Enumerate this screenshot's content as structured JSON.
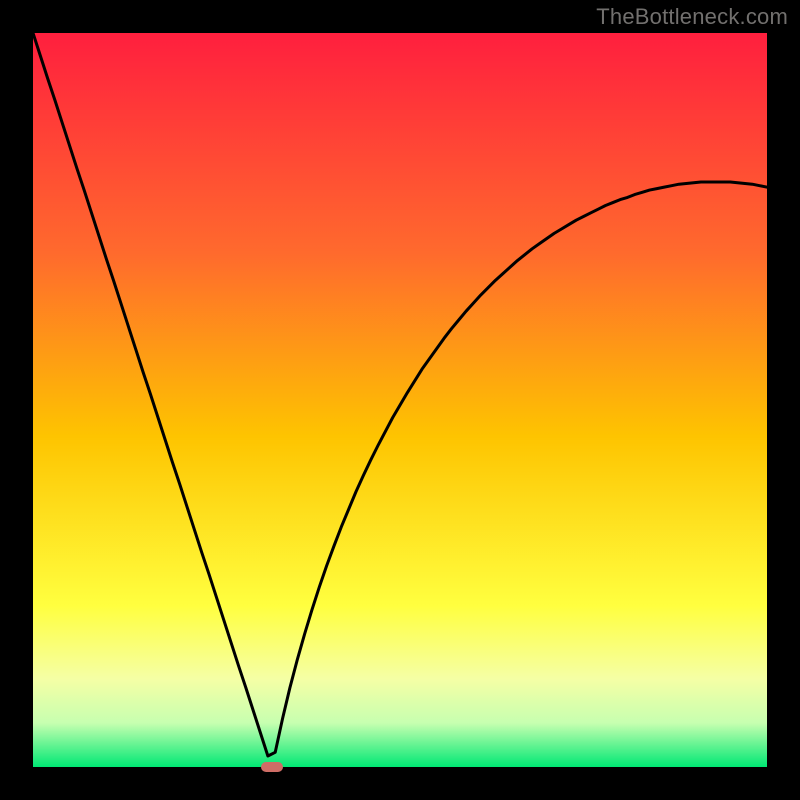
{
  "attribution": "TheBottleneck.com",
  "chart_data": {
    "type": "line",
    "title": "",
    "xlabel": "",
    "ylabel": "",
    "xlim": [
      0,
      1
    ],
    "ylim": [
      0,
      1
    ],
    "x": [
      0.0,
      0.01,
      0.02,
      0.03,
      0.04,
      0.05,
      0.06,
      0.07,
      0.08,
      0.09,
      0.1,
      0.11,
      0.12,
      0.13,
      0.14,
      0.15,
      0.16,
      0.17,
      0.18,
      0.19,
      0.2,
      0.21,
      0.22,
      0.23,
      0.24,
      0.25,
      0.26,
      0.27,
      0.28,
      0.29,
      0.3,
      0.31,
      0.32,
      0.33,
      0.34,
      0.35,
      0.36,
      0.37,
      0.38,
      0.39,
      0.4,
      0.41,
      0.42,
      0.43,
      0.44,
      0.45,
      0.46,
      0.47,
      0.48,
      0.49,
      0.5,
      0.51,
      0.52,
      0.53,
      0.54,
      0.55,
      0.56,
      0.57,
      0.58,
      0.59,
      0.6,
      0.61,
      0.62,
      0.63,
      0.64,
      0.65,
      0.66,
      0.67,
      0.68,
      0.69,
      0.7,
      0.71,
      0.72,
      0.73,
      0.74,
      0.75,
      0.76,
      0.77,
      0.78,
      0.79,
      0.8,
      0.81,
      0.82,
      0.83,
      0.84,
      0.85,
      0.86,
      0.87,
      0.88,
      0.89,
      0.9,
      0.91,
      0.92,
      0.93,
      0.94,
      0.95,
      0.96,
      0.97,
      0.98,
      0.99,
      1.0
    ],
    "values": [
      1.0,
      0.969,
      0.938,
      0.908,
      0.877,
      0.846,
      0.815,
      0.785,
      0.754,
      0.723,
      0.692,
      0.662,
      0.631,
      0.6,
      0.569,
      0.538,
      0.508,
      0.477,
      0.446,
      0.415,
      0.385,
      0.354,
      0.323,
      0.292,
      0.262,
      0.231,
      0.2,
      0.169,
      0.138,
      0.108,
      0.077,
      0.046,
      0.015,
      0.02,
      0.066,
      0.108,
      0.146,
      0.181,
      0.214,
      0.245,
      0.274,
      0.301,
      0.327,
      0.351,
      0.375,
      0.397,
      0.418,
      0.438,
      0.457,
      0.476,
      0.493,
      0.51,
      0.526,
      0.542,
      0.556,
      0.57,
      0.584,
      0.597,
      0.609,
      0.621,
      0.632,
      0.643,
      0.653,
      0.663,
      0.672,
      0.681,
      0.69,
      0.698,
      0.706,
      0.713,
      0.72,
      0.727,
      0.733,
      0.739,
      0.745,
      0.75,
      0.755,
      0.76,
      0.765,
      0.769,
      0.773,
      0.776,
      0.78,
      0.783,
      0.786,
      0.788,
      0.79,
      0.792,
      0.794,
      0.795,
      0.796,
      0.797,
      0.797,
      0.797,
      0.797,
      0.797,
      0.796,
      0.795,
      0.794,
      0.792,
      0.79
    ],
    "minimum_x": 0.325,
    "marker": {
      "x": 0.325,
      "y": 0.0,
      "color": "#cf6d66"
    },
    "background_gradient": {
      "stops": [
        {
          "pos": 0.0,
          "color": "#ff1f3e"
        },
        {
          "pos": 0.3,
          "color": "#ff6a2d"
        },
        {
          "pos": 0.55,
          "color": "#fec400"
        },
        {
          "pos": 0.78,
          "color": "#ffff3f"
        },
        {
          "pos": 0.88,
          "color": "#f5ffa5"
        },
        {
          "pos": 0.94,
          "color": "#c7ffb0"
        },
        {
          "pos": 1.0,
          "color": "#00e874"
        }
      ]
    }
  }
}
